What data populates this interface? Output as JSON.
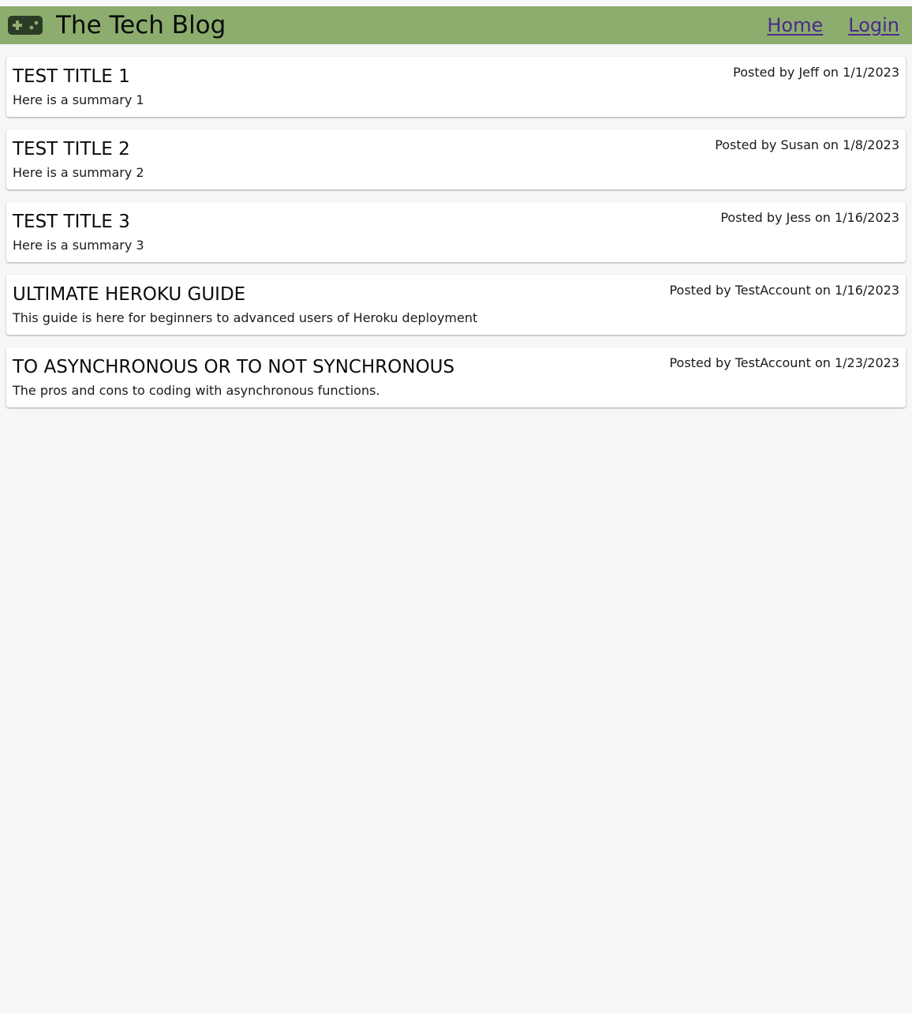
{
  "header": {
    "title": "The Tech Blog",
    "logo_icon": "gamepad-icon",
    "background_color": "#8cad6d",
    "nav": [
      {
        "label": "Home"
      },
      {
        "label": "Login"
      }
    ]
  },
  "posts": [
    {
      "title": "TEST TITLE 1",
      "summary": "Here is a summary 1",
      "meta": "Posted by Jeff on 1/1/2023"
    },
    {
      "title": "TEST TITLE 2",
      "summary": "Here is a summary 2",
      "meta": "Posted by Susan on 1/8/2023"
    },
    {
      "title": "TEST TITLE 3",
      "summary": "Here is a summary 3",
      "meta": "Posted by Jess on 1/16/2023"
    },
    {
      "title": "ULTIMATE HEROKU GUIDE",
      "summary": "This guide is here for beginners to advanced users of Heroku deployment",
      "meta": "Posted by TestAccount on 1/16/2023"
    },
    {
      "title": "TO ASYNCHRONOUS OR TO NOT SYNCHRONOUS",
      "summary": "The pros and cons to coding with asynchronous functions.",
      "meta": "Posted by TestAccount on 1/23/2023"
    }
  ]
}
